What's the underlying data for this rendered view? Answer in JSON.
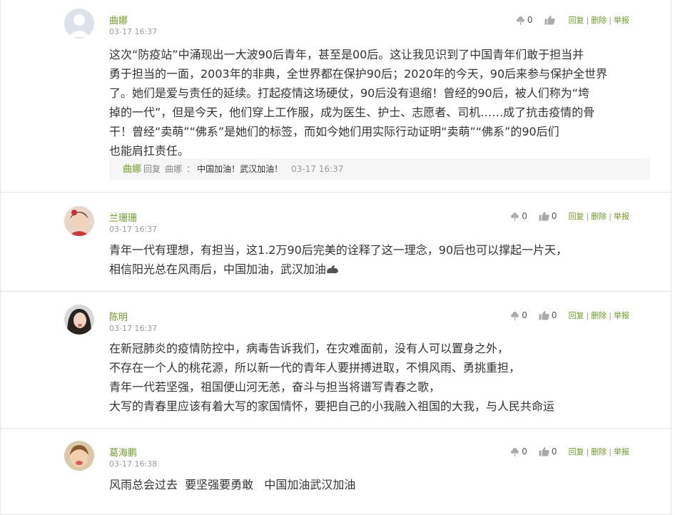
{
  "comments": [
    {
      "user": "曲娜",
      "time": "03-17 16:37",
      "dislikes": "0",
      "likes": "",
      "reply_label": "回复",
      "delete_label": "删除",
      "report_label": "举报",
      "text": "这次“防疫站”中涌现出一大波90后青年，甚至是00后。这让我见识到了中国青年们敢于担当并\n勇于担当的一面，2003年的非典，全世界都在保护90后；2020年的今天，90后来参与保护全世界\n了。她们是爱与责任的延续。打起疫情这场硬仗，90后没有退缩！曾经的90后，被人们称为“垮\n掉的一代”，但是今天，他们穿上工作服，成为医生、护士、志愿者、司机……成了抗击疫情的骨\n干！曾经“卖萌”“佛系”是她们的标签，而如今她们用实际行动证明“卖萌”“佛系”的90后们\n也能肩扛责任。",
      "reply": {
        "user": "曲娜",
        "verb": "回复",
        "target": "曲娜",
        "colon": "：",
        "text": "中国加油！武汉加油！",
        "time": "03-17 16:37"
      }
    },
    {
      "user": "兰珊珊",
      "time": "03-17 16:37",
      "dislikes": "0",
      "likes": "0",
      "reply_label": "回复",
      "delete_label": "删除",
      "report_label": "举报",
      "text": "青年一代有理想，有担当，这1.2万90后完美的诠释了这一理念，90后也可以撑起一片天，\n相信阳光总在风雨后，中国加油，武汉加油"
    },
    {
      "user": "陈明",
      "time": "03-17 16:37",
      "dislikes": "0",
      "likes": "0",
      "reply_label": "回复",
      "delete_label": "删除",
      "report_label": "举报",
      "text": "在新冠肺炎的疫情防控中，病毒告诉我们，在灾难面前，没有人可以置身之外，\n不存在一个人的桃花源，所以新一代的青年人要拼搏进取，不惧风雨、勇挑重担，\n青年一代若坚强，祖国便山河无恙，奋斗与担当将谱写青春之歌，\n大写的青春里应该有着大写的家国情怀，要把自己的小我融入祖国的大我，与人民共命运"
    },
    {
      "user": "葛海鹏",
      "time": "03-17 16:38",
      "dislikes": "0",
      "likes": "0",
      "reply_label": "回复",
      "delete_label": "删除",
      "report_label": "举报",
      "text": "风雨总会过去  要坚强要勇敢   中国加油武汉加油"
    }
  ],
  "colors": {
    "accent": "#6f9a2a",
    "muted": "#999999",
    "text": "#333333",
    "reply_bg": "#f6f6f6"
  },
  "icons": {
    "dislike": "flower-icon",
    "like": "thumbs-up-icon",
    "emoji": "flexed-biceps-icon"
  }
}
